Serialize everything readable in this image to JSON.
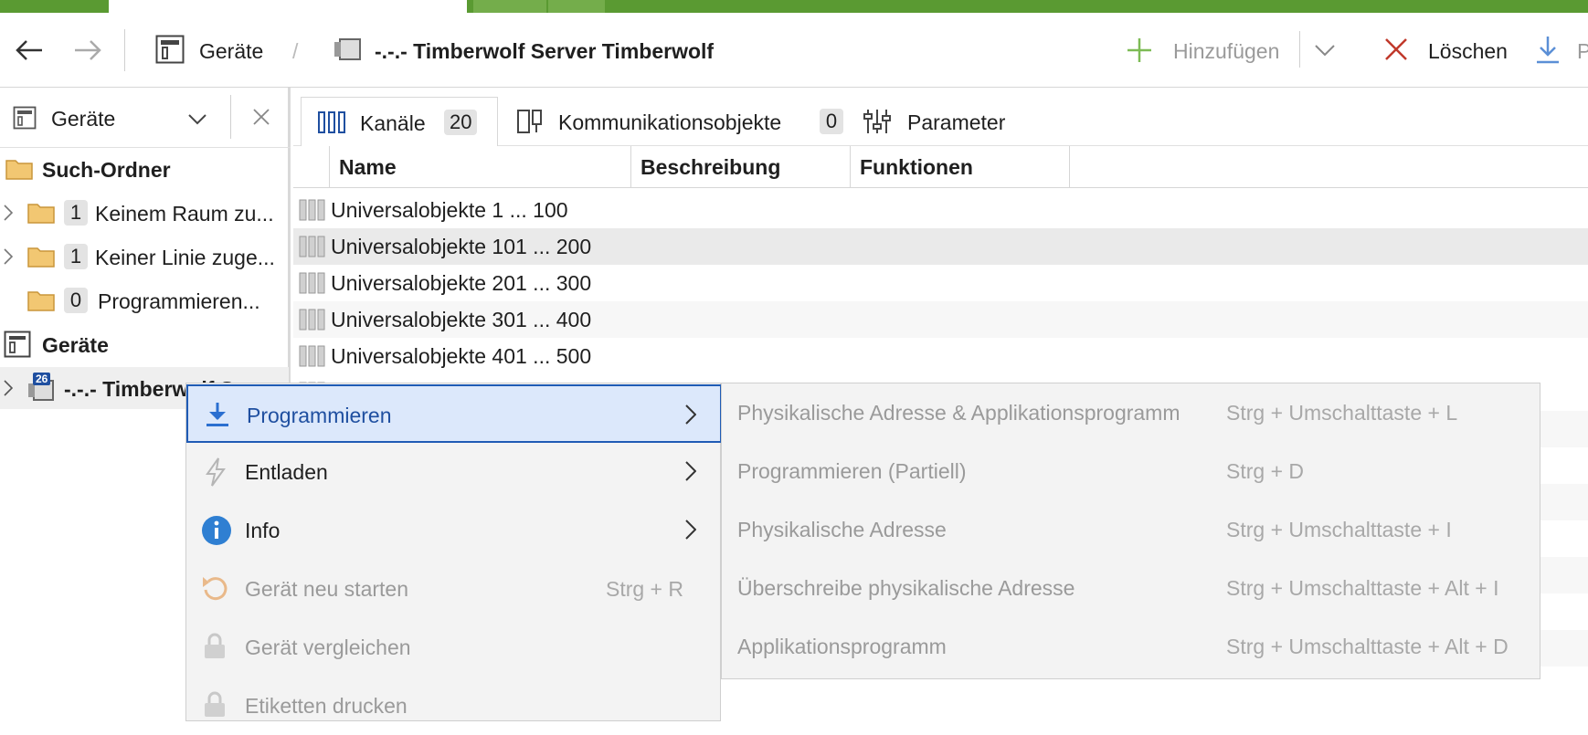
{
  "colors": {
    "brand_green": "#5a9a32",
    "accent_blue": "#1f5bb5",
    "highlight_bg": "#dce8fb",
    "delete_red": "#c0392b",
    "add_green": "#6aaa44"
  },
  "toolbar": {
    "back_icon": "arrow-left-icon",
    "forward_icon": "arrow-right-icon",
    "breadcrumb_root": "Geräte",
    "breadcrumb_sep": "/",
    "breadcrumb_device": "-.-.- Timberwolf Server Timberwolf",
    "add_label": "Hinzufügen",
    "delete_label": "Löschen",
    "truncated_label": "P"
  },
  "left_panel": {
    "view_selector": "Geräte",
    "tree": {
      "search_folder": "Such-Ordner",
      "items": [
        {
          "count": "1",
          "label": "Keinem Raum zu..."
        },
        {
          "count": "1",
          "label": "Keiner Linie zuge..."
        },
        {
          "count": "0",
          "label": "Programmieren..."
        }
      ],
      "devices_root": "Geräte",
      "device": {
        "badge": "26",
        "label": "-.-.- Timberwolf S..."
      }
    }
  },
  "main": {
    "tabs": [
      {
        "label": "Kanäle",
        "count": "20"
      },
      {
        "label": "Kommunikationsobjekte",
        "count": "0"
      },
      {
        "label": "Parameter"
      }
    ],
    "columns": [
      "Name",
      "Beschreibung",
      "Funktionen"
    ],
    "rows": [
      "Universalobjekte 1 ... 100",
      "Universalobjekte 101 ... 200",
      "Universalobjekte 201 ... 300",
      "Universalobjekte 301 ... 400",
      "Universalobjekte 401 ... 500"
    ]
  },
  "context_menu": {
    "items": [
      {
        "label": "Programmieren",
        "icon": "download-icon",
        "submenu": true
      },
      {
        "label": "Entladen",
        "icon": "lightning-icon",
        "submenu": true
      },
      {
        "label": "Info",
        "icon": "info-icon",
        "submenu": true
      },
      {
        "label": "Gerät neu starten",
        "icon": "restart-icon",
        "shortcut": "Strg + R"
      },
      {
        "label": "Gerät vergleichen",
        "icon": "lock-icon"
      },
      {
        "label": "Etiketten drucken",
        "icon": "lock-icon"
      }
    ]
  },
  "submenu": {
    "items": [
      {
        "label": "Physikalische Adresse & Applikationsprogramm",
        "shortcut": "Strg + Umschalttaste + L"
      },
      {
        "label": "Programmieren (Partiell)",
        "shortcut": "Strg + D"
      },
      {
        "label": "Physikalische Adresse",
        "shortcut": "Strg + Umschalttaste + I"
      },
      {
        "label": "Überschreibe physikalische Adresse",
        "shortcut": "Strg + Umschalttaste + Alt + I"
      },
      {
        "label": "Applikationsprogramm",
        "shortcut": "Strg + Umschalttaste + Alt + D"
      }
    ]
  }
}
